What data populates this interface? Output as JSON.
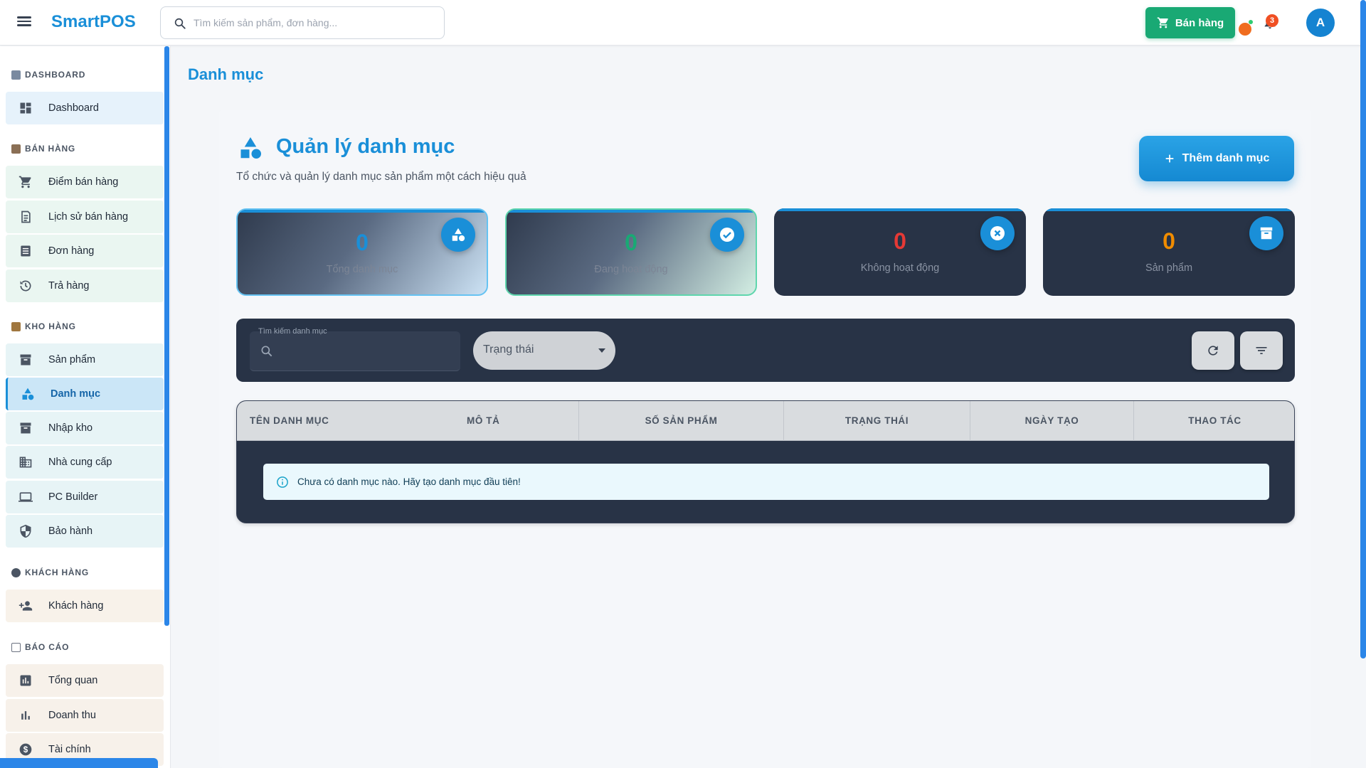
{
  "app": {
    "brand": "SmartPOS",
    "search_placeholder": "Tìm kiếm sản phẩm, đơn hàng...",
    "sell_button": "Bán hàng",
    "notification_count": "3",
    "avatar_initial": "A"
  },
  "sidebar": {
    "sections": [
      {
        "title": "DASHBOARD",
        "items": [
          {
            "label": "Dashboard",
            "icon": "dashboard-icon"
          }
        ]
      },
      {
        "title": "BÁN HÀNG",
        "items": [
          {
            "label": "Điểm bán hàng",
            "icon": "cart-icon"
          },
          {
            "label": "Lịch sử bán hàng",
            "icon": "receipt-icon"
          },
          {
            "label": "Đơn hàng",
            "icon": "list-icon"
          },
          {
            "label": "Trả hàng",
            "icon": "history-icon"
          }
        ]
      },
      {
        "title": "KHO HÀNG",
        "items": [
          {
            "label": "Sản phẩm",
            "icon": "inventory-icon"
          },
          {
            "label": "Danh mục",
            "icon": "category-icon"
          },
          {
            "label": "Nhập kho",
            "icon": "inventory-icon"
          },
          {
            "label": "Nhà cung cấp",
            "icon": "building-icon"
          },
          {
            "label": "PC Builder",
            "icon": "laptop-icon"
          },
          {
            "label": "Bảo hành",
            "icon": "shield-icon"
          }
        ]
      },
      {
        "title": "KHÁCH HÀNG",
        "items": [
          {
            "label": "Khách hàng",
            "icon": "person-add-icon"
          }
        ]
      },
      {
        "title": "BÁO CÁO",
        "items": [
          {
            "label": "Tổng quan",
            "icon": "chart-icon"
          },
          {
            "label": "Doanh thu",
            "icon": "bar-chart-icon"
          },
          {
            "label": "Tài chính",
            "icon": "dollar-icon"
          }
        ]
      }
    ]
  },
  "page": {
    "title": "Danh mục",
    "header_title": "Quản lý danh mục",
    "header_subtitle": "Tổ chức và quản lý danh mục sản phẩm một cách hiệu quả",
    "add_button": "Thêm danh mục"
  },
  "stats": [
    {
      "value": "0",
      "label": "Tổng danh mục",
      "color": "#1a8fd8"
    },
    {
      "value": "0",
      "label": "Đang hoạt động",
      "color": "#19a974"
    },
    {
      "value": "0",
      "label": "Không hoạt động",
      "color": "#e53935"
    },
    {
      "value": "0",
      "label": "Sản phẩm",
      "color": "#f08c00"
    }
  ],
  "filters": {
    "search_label": "Tìm kiếm danh mục",
    "status_value": "Trạng thái"
  },
  "table": {
    "columns": [
      "TÊN DANH MỤC",
      "MÔ TẢ",
      "SỐ SẢN PHẨM",
      "TRẠNG THÁI",
      "NGÀY TẠO",
      "THAO TÁC"
    ],
    "empty_message": "Chưa có danh mục nào. Hãy tạo danh mục đầu tiên!"
  },
  "colors": {
    "accent": "#1a8fd8",
    "success": "#19a974",
    "danger": "#e53935",
    "warning": "#f08c00",
    "dark_panel": "#283346"
  }
}
